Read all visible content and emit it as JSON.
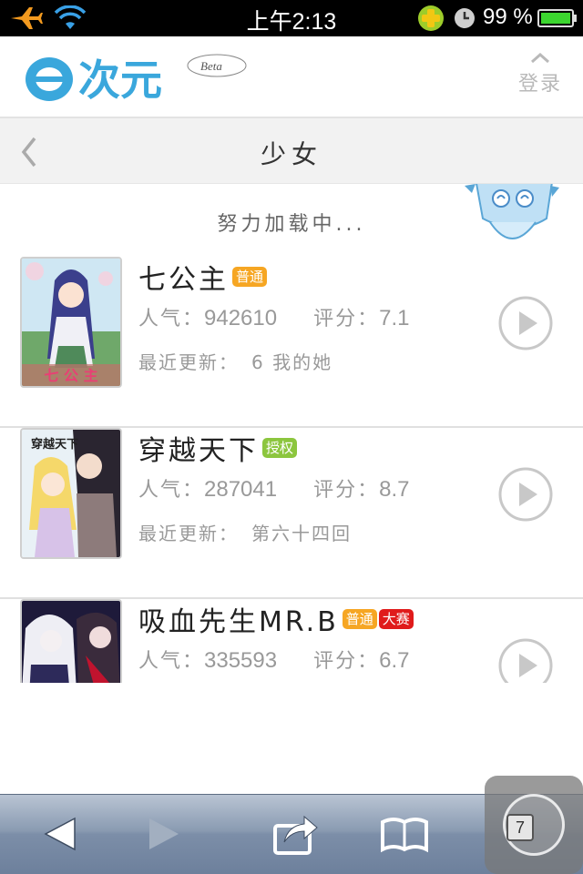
{
  "status_bar": {
    "time": "上午2:13",
    "battery_percent": "99 %",
    "icons": [
      "airplane-icon",
      "wifi-icon",
      "plus-icon",
      "clock-icon",
      "battery-icon"
    ]
  },
  "header": {
    "logo_text": "次元",
    "logo_beta": "Beta",
    "login_label": "登录"
  },
  "category_bar": {
    "title": "少女"
  },
  "loading_text": "努力加载中...",
  "list": {
    "items": [
      {
        "title": "七公主",
        "badges": [
          {
            "text": "普通",
            "color": "#f6a623"
          }
        ],
        "popularity_label": "人气：",
        "popularity": "942610",
        "score_label": "评分：",
        "score": "7.1",
        "update_label": "最近更新：",
        "update_value": "6 我的她",
        "cover_text": "七 公 主"
      },
      {
        "title": "穿越天下",
        "badges": [
          {
            "text": "授权",
            "color": "#8cc63e"
          }
        ],
        "popularity_label": "人气：",
        "popularity": "287041",
        "score_label": "评分：",
        "score": "8.7",
        "update_label": "最近更新：",
        "update_value": "第六十四回",
        "cover_text": "穿越天下"
      },
      {
        "title": "吸血先生MR.B",
        "badges": [
          {
            "text": "普通",
            "color": "#f6a623"
          },
          {
            "text": "大赛",
            "color": "#e01b1b"
          }
        ],
        "popularity_label": "人气：",
        "popularity": "335593",
        "score_label": "评分：",
        "score": "6.7"
      }
    ]
  },
  "toolbar": {
    "tab_count": "7",
    "icons": [
      "back-arrow-icon",
      "forward-arrow-icon",
      "share-icon",
      "bookmarks-icon",
      "tabs-icon"
    ]
  },
  "colors": {
    "accent_blue": "#3aa7dc",
    "badge_orange": "#f6a623",
    "badge_green": "#8cc63e",
    "badge_red": "#e01b1b"
  }
}
